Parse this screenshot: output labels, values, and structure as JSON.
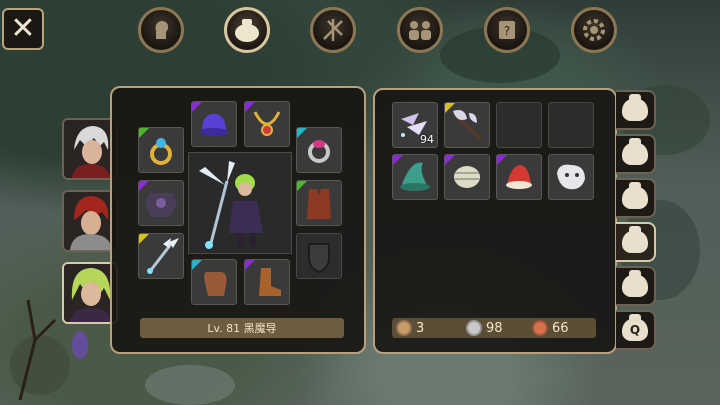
{
  "top_bar": {
    "close_glyph": "✕",
    "icons": [
      {
        "name": "character-icon",
        "active": false
      },
      {
        "name": "inventory-bag-icon",
        "active": true
      },
      {
        "name": "skills-icon",
        "active": false
      },
      {
        "name": "party-icon",
        "active": false
      },
      {
        "name": "quest-scroll-icon",
        "active": false
      },
      {
        "name": "settings-gear-icon",
        "active": false
      }
    ]
  },
  "character": {
    "level_label": "Lv. 81 黑魔导"
  },
  "portraits": [
    {
      "name": "white-hair-hero",
      "active": false
    },
    {
      "name": "red-hair-knight",
      "active": false
    },
    {
      "name": "green-hair-mage",
      "active": true
    }
  ],
  "equipment": {
    "slots": [
      {
        "id": "helmet",
        "rarity": "purple",
        "icon": "purple-hat-icon"
      },
      {
        "id": "necklace",
        "rarity": "purple",
        "icon": "gold-necklace-icon"
      },
      {
        "id": "ring-left",
        "rarity": "green",
        "icon": "gold-ring-icon"
      },
      {
        "id": "ring-right",
        "rarity": "cyan",
        "icon": "ruby-ring-icon"
      },
      {
        "id": "armor",
        "rarity": "purple",
        "icon": "dark-armor-icon"
      },
      {
        "id": "cloak",
        "rarity": "green",
        "icon": "red-vest-icon"
      },
      {
        "id": "weapon",
        "rarity": "yellow",
        "icon": "winged-staff-icon"
      },
      {
        "id": "offhand",
        "rarity": "none",
        "icon": "empty-shield-icon"
      },
      {
        "id": "gloves",
        "rarity": "cyan",
        "icon": "brown-glove-icon"
      },
      {
        "id": "boots",
        "rarity": "purple",
        "icon": "leather-boots-icon"
      }
    ]
  },
  "inventory": {
    "items": [
      {
        "icon": "crystal-shards-icon",
        "rarity": "none",
        "count": "94"
      },
      {
        "icon": "battle-axe-icon",
        "rarity": "yellow",
        "count": ""
      },
      {
        "icon": "",
        "rarity": "none",
        "count": ""
      },
      {
        "icon": "",
        "rarity": "none",
        "count": ""
      },
      {
        "icon": "green-mage-hat-icon",
        "rarity": "purple",
        "count": ""
      },
      {
        "icon": "bandage-wrap-icon",
        "rarity": "purple",
        "count": ""
      },
      {
        "icon": "red-cap-icon",
        "rarity": "purple",
        "count": ""
      },
      {
        "icon": "white-beast-mask-icon",
        "rarity": "none",
        "count": ""
      }
    ],
    "currency": {
      "bronze": "3",
      "silver": "98",
      "red": "66",
      "colors": {
        "bronze": "#c79a6a",
        "silver": "#c9c9c9",
        "red": "#d7704e"
      }
    },
    "tabs": [
      {
        "label": "",
        "icon": "bag-icon",
        "active": false
      },
      {
        "label": "",
        "icon": "bag-icon",
        "active": false
      },
      {
        "label": "",
        "icon": "bag-icon",
        "active": false
      },
      {
        "label": "",
        "icon": "bag-icon",
        "active": true
      },
      {
        "label": "",
        "icon": "bag-icon",
        "active": false
      },
      {
        "label": "Q",
        "icon": "quest-bag-icon",
        "active": false
      }
    ]
  }
}
